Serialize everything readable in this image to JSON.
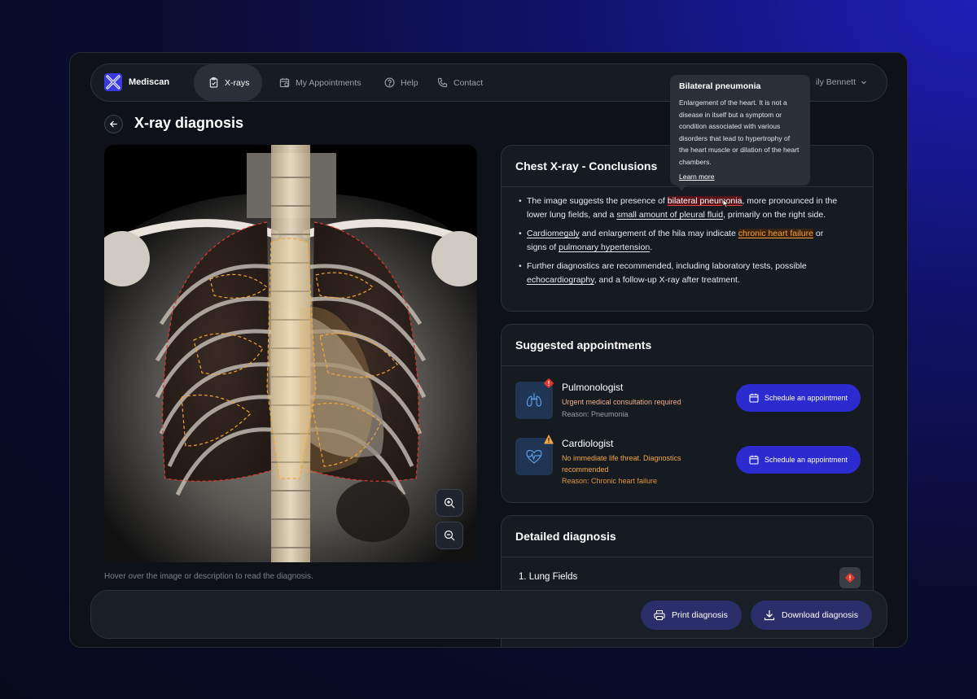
{
  "nav": {
    "brand": "Mediscan",
    "items": [
      {
        "label": "X-rays",
        "icon": "clipboard-icon",
        "active": true
      },
      {
        "label": "My Appointments",
        "icon": "calendar-icon",
        "active": false
      },
      {
        "label": "Help",
        "icon": "help-icon",
        "active": false
      },
      {
        "label": "Contact",
        "icon": "phone-icon",
        "active": false
      }
    ],
    "user": "ily Bennett"
  },
  "page": {
    "title": "X-ray diagnosis",
    "hint": "Hover over the image or description to read the diagnosis."
  },
  "conclusions": {
    "title": "Chest X-ray - Conclusions",
    "b1_t1": "The image suggests the presence of ",
    "b1_link1": "bilateral pneumonia",
    "b1_t2": ", more pronounced in the lower lung fields, and a ",
    "b1_link2": "small amount of pleural fluid",
    "b1_t3": ", primarily on the right side.",
    "b2_link1": "Cardiomegaly",
    "b2_t1": " and enlargement of the hila may indicate ",
    "b2_link2": "chronic heart failure",
    "b2_t2": " or signs of ",
    "b2_link3": "pulmonary hypertension",
    "b2_t3": ".",
    "b3_t1": "Further diagnostics are recommended, including laboratory tests, possible ",
    "b3_link1": "echocardiography",
    "b3_t2": ", and a follow-up X-ray after treatment."
  },
  "tooltip": {
    "title": "Bilateral pneumonia",
    "body": "Enlargement of the heart. It is not a disease in itself but a symptom or condition associated with various disorders that lead to hypertrophy of the heart muscle or dilation of the heart chambers.",
    "link": "Learn more"
  },
  "appointments": {
    "title": "Suggested appointments",
    "items": [
      {
        "name": "Pulmonologist",
        "desc": "Urgent medical consultation required",
        "reason": "Reason: Pneumonia",
        "button": "Schedule an appointment",
        "color": "#f0b090"
      },
      {
        "name": "Cardiologist",
        "desc": "No immediate life threat. Diagnostics recommended",
        "reason": "Reason: Chronic heart failure",
        "button": "Schedule an appointment",
        "color": "#f5a742"
      }
    ]
  },
  "detailed": {
    "title": "Detailed diagnosis",
    "item1": "1. Lung Fields"
  },
  "actions": {
    "print": "Print diagnosis",
    "download": "Download diagnosis"
  }
}
